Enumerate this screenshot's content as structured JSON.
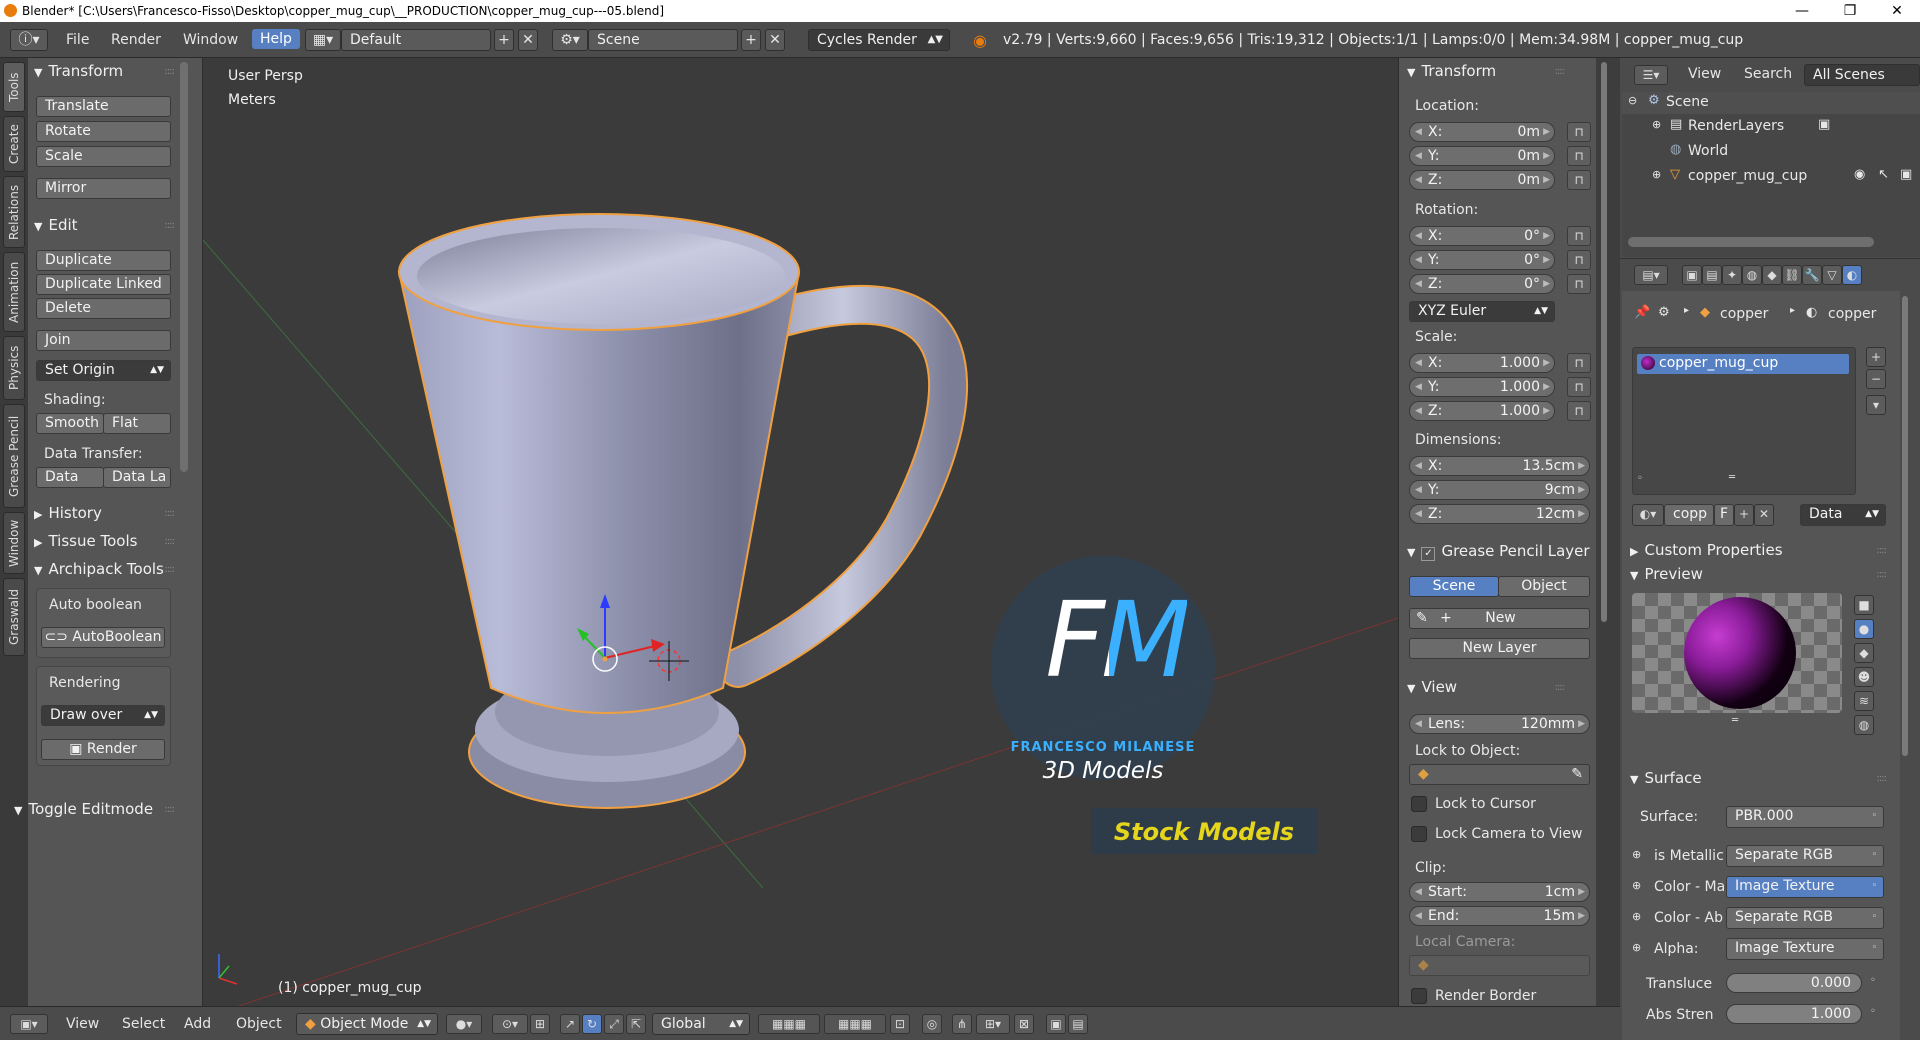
{
  "window": {
    "title": "Blender* [C:\\Users\\Francesco-Fisso\\Desktop\\copper_mug_cup\\__PRODUCTION\\copper_mug_cup---05.blend]",
    "minimize": "—",
    "maximize": "❐",
    "close": "✕"
  },
  "header": {
    "menus": [
      "File",
      "Render",
      "Window",
      "Help"
    ],
    "screen_layout": "Default",
    "scene": "Scene",
    "engine": "Cycles Render",
    "stats": "v2.79 | Verts:9,660 | Faces:9,656 | Tris:19,312 | Objects:1/1 | Lamps:0/0 | Mem:34.98M | copper_mug_cup"
  },
  "tool_tabs": [
    "Tools",
    "Create",
    "Relations",
    "Animation",
    "Physics",
    "Grease Pencil",
    "Window",
    "Graswald"
  ],
  "toolshelf": {
    "transform_title": "Transform",
    "translate": "Translate",
    "rotate": "Rotate",
    "scale": "Scale",
    "mirror": "Mirror",
    "edit_title": "Edit",
    "duplicate": "Duplicate",
    "duplicate_linked": "Duplicate Linked",
    "delete": "Delete",
    "join": "Join",
    "set_origin": "Set Origin",
    "shading_label": "Shading:",
    "smooth": "Smooth",
    "flat": "Flat",
    "data_transfer_label": "Data Transfer:",
    "data": "Data",
    "data_layout": "Data La",
    "history": "History",
    "tissue_tools": "Tissue Tools",
    "archipack": "Archipack Tools",
    "auto_boolean_label": "Auto boolean",
    "auto_boolean_btn": "AutoBoolean",
    "rendering_label": "Rendering",
    "draw_over": "Draw over",
    "render": "Render",
    "toggle_editmode": "Toggle Editmode"
  },
  "viewport": {
    "view_name": "User Persp",
    "units": "Meters",
    "object_label": "(1) copper_mug_cup",
    "watermark_big": "FM",
    "watermark_name": "FRANCESCO MILANESE",
    "watermark_sub": "3D Models",
    "watermark_stock": "Stock Models"
  },
  "npanel": {
    "transform_title": "Transform",
    "location_label": "Location:",
    "loc": [
      {
        "k": "X:",
        "v": "0m"
      },
      {
        "k": "Y:",
        "v": "0m"
      },
      {
        "k": "Z:",
        "v": "0m"
      }
    ],
    "rotation_label": "Rotation:",
    "rot": [
      {
        "k": "X:",
        "v": "0°"
      },
      {
        "k": "Y:",
        "v": "0°"
      },
      {
        "k": "Z:",
        "v": "0°"
      }
    ],
    "rotation_mode": "XYZ Euler",
    "scale_label": "Scale:",
    "scl": [
      {
        "k": "X:",
        "v": "1.000"
      },
      {
        "k": "Y:",
        "v": "1.000"
      },
      {
        "k": "Z:",
        "v": "1.000"
      }
    ],
    "dimensions_label": "Dimensions:",
    "dim": [
      {
        "k": "X:",
        "v": "13.5cm"
      },
      {
        "k": "Y:",
        "v": "9cm"
      },
      {
        "k": "Z:",
        "v": "12cm"
      }
    ],
    "grease_title": "Grease Pencil Layer",
    "gp_scene": "Scene",
    "gp_object": "Object",
    "gp_new": "New",
    "gp_new_layer": "New Layer",
    "view_title": "View",
    "lens": {
      "k": "Lens:",
      "v": "120mm"
    },
    "lock_object_label": "Lock to Object:",
    "lock_cursor": "Lock to Cursor",
    "lock_camera": "Lock Camera to View",
    "clip_label": "Clip:",
    "clip_start": {
      "k": "Start:",
      "v": "1cm"
    },
    "clip_end": {
      "k": "End:",
      "v": "15m"
    },
    "local_camera_label": "Local Camera:",
    "render_border": "Render Border"
  },
  "outliner": {
    "view": "View",
    "search": "Search",
    "filter": "All Scenes",
    "items": [
      "Scene",
      "RenderLayers",
      "World",
      "copper_mug_cup"
    ]
  },
  "properties": {
    "breadcrumb_1": "copper",
    "breadcrumb_2": "copper",
    "material_slot": "copper_mug_cup",
    "mat_name_short": "copp",
    "fake_user": "F",
    "link": "Data",
    "custom_props": "Custom Properties",
    "preview": "Preview",
    "surface_title": "Surface",
    "surface_label": "Surface:",
    "surface_value": "PBR.000",
    "rows": [
      {
        "k": "is Metallic",
        "v": "Separate RGB"
      },
      {
        "k": "Color - Ma",
        "v": "Image Texture"
      },
      {
        "k": "Color - Ab",
        "v": "Separate RGB"
      },
      {
        "k": "Alpha:",
        "v": "Image Texture"
      }
    ],
    "translucency": {
      "k": "Transluce",
      "v": "0.000"
    },
    "abs_strength": {
      "k": "Abs Stren",
      "v": "1.000"
    }
  },
  "bottombar": {
    "view": "View",
    "select": "Select",
    "add": "Add",
    "object": "Object",
    "mode": "Object Mode",
    "orientation": "Global"
  },
  "colors": {
    "accent": "#5680c2",
    "selection": "#e08a2a",
    "bg": "#3b3b3b"
  }
}
